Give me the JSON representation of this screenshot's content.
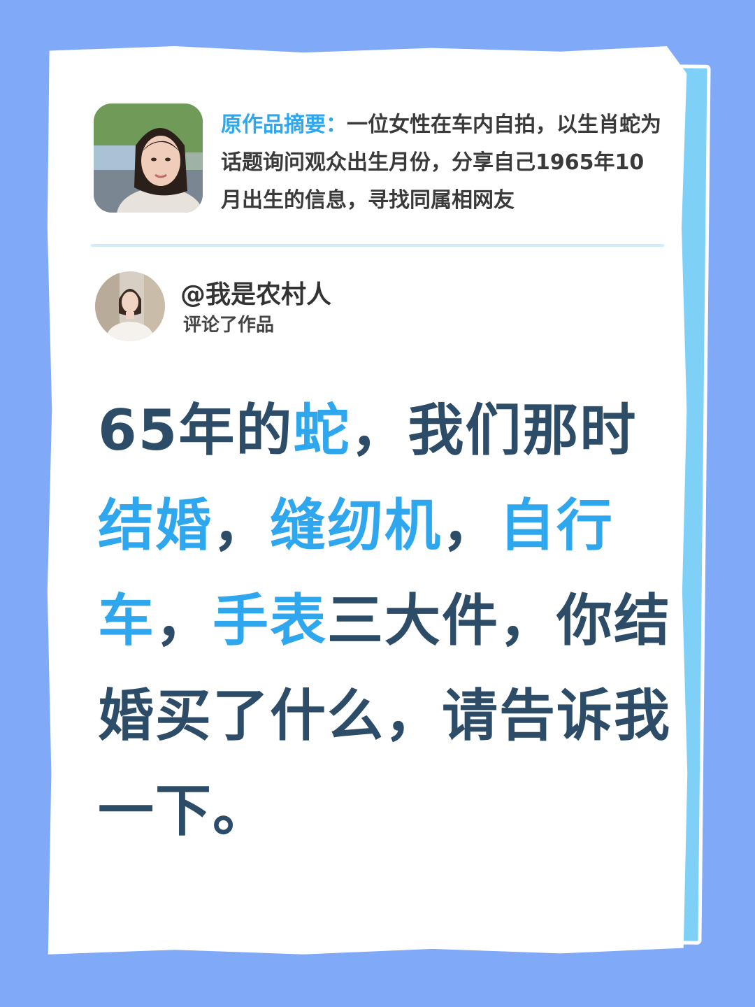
{
  "summary": {
    "label": "原作品摘要：",
    "text": "一位女性在车内自拍，以生肖蛇为话题询问观众出生月份，分享自己1965年10月出生的信息，寻找同属相网友"
  },
  "comment": {
    "username": "@我是农村人",
    "action": "评论了作品",
    "body_segments": [
      {
        "text": "65年的",
        "highlight": false
      },
      {
        "text": "蛇",
        "highlight": true
      },
      {
        "text": "，我们那时",
        "highlight": false
      },
      {
        "text": "结婚",
        "highlight": true
      },
      {
        "text": "，",
        "highlight": false
      },
      {
        "text": "缝纫机",
        "highlight": true
      },
      {
        "text": "，",
        "highlight": false
      },
      {
        "text": "自行车",
        "highlight": true
      },
      {
        "text": "，",
        "highlight": false
      },
      {
        "text": "手表",
        "highlight": true
      },
      {
        "text": "三大件，你结婚买了什么，请告诉我一下。",
        "highlight": false
      }
    ]
  },
  "colors": {
    "background": "#80a9f7",
    "accent": "#2fa7ee",
    "body_text": "#2c4c68"
  }
}
